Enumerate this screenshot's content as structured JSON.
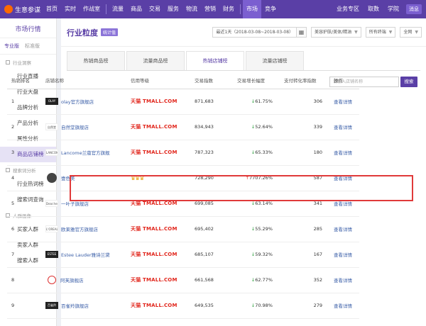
{
  "app": {
    "logo_text": "生意参谋"
  },
  "topnav": {
    "items": [
      "首页",
      "实时",
      "作战室",
      "流量",
      "商品",
      "交易",
      "服务",
      "物流",
      "营销",
      "财务",
      "市场",
      "竞争"
    ],
    "active_index": 10,
    "right_items": [
      "业务专区",
      "取数",
      "学院"
    ],
    "user_label": "消息"
  },
  "sidebar": {
    "title": "市场行情",
    "tabs": [
      "专业版",
      "标准版"
    ],
    "groups": [
      {
        "label": "行业洞察",
        "items": [
          "行业直播",
          "行业大盘",
          "品牌分析",
          "产品分析",
          "属性分析",
          "商品店铺榜"
        ]
      },
      {
        "label": "搜索词分析",
        "items": [
          "行业热词榜",
          "搜索词查询"
        ]
      },
      {
        "label": "人群画像",
        "items": [
          "买家人群",
          "卖家人群",
          "搜索人群"
        ]
      }
    ],
    "active_item": "商品店铺榜"
  },
  "main": {
    "title": "行业粒度",
    "title_badge": "统计值",
    "date_range": "最近1天（2018-03-08~2018-03-08）",
    "category_select": "美容护肤/美体/精油",
    "terminal_select": "所有终端",
    "scope_select": "全网",
    "tabs": [
      "热销商品榜",
      "流量商品榜",
      "热销店铺榜",
      "流量店铺榜"
    ],
    "active_tab": 2,
    "search": {
      "placeholder": "请输入店铺名称",
      "button": "搜索"
    }
  },
  "table": {
    "headers": [
      "热销排名",
      "店铺名称",
      "信用等级",
      "交易指数",
      "交易增长幅度",
      "支付转化率指数",
      "操作"
    ],
    "rows": [
      {
        "rank": "1",
        "logo": "OLAY",
        "logo_style": "dark",
        "name": "olay官方旗舰店",
        "credit": "天猫 TMALL.COM",
        "credit_type": "tmall",
        "index": "871,683",
        "growth": "61.75%",
        "growth_dir": "down",
        "conv": "306",
        "action": "查看详情"
      },
      {
        "rank": "2",
        "logo": "自然堂",
        "logo_style": "light",
        "name": "自然堂旗舰店",
        "credit": "天猫 TMALL.COM",
        "credit_type": "tmall",
        "index": "834,943",
        "growth": "52.64%",
        "growth_dir": "down",
        "conv": "339",
        "action": "查看详情"
      },
      {
        "rank": "3",
        "logo": "LANCOME",
        "logo_style": "light",
        "name": "Lancome兰蔻官方旗舰",
        "credit": "天猫 TMALL.COM",
        "credit_type": "tmall",
        "index": "787,323",
        "growth": "65.33%",
        "growth_dir": "down",
        "conv": "180",
        "action": "查看详情"
      },
      {
        "rank": "4",
        "logo": "",
        "logo_style": "round",
        "name": "壹色美",
        "credit": "♛♛♛",
        "credit_type": "crown",
        "index": "728,290",
        "growth": "7707.26%",
        "growth_dir": "up",
        "conv": "587",
        "action": "查看详情"
      },
      {
        "rank": "5",
        "logo": "Dear.her",
        "logo_style": "light",
        "name": "一叶子旗舰店",
        "credit": "天猫 TMALL.COM",
        "credit_type": "tmall",
        "index": "699,085",
        "growth": "63.14%",
        "growth_dir": "down",
        "conv": "341",
        "action": "查看详情"
      },
      {
        "rank": "6",
        "logo": "L'OREAL",
        "logo_style": "light",
        "name": "欧莱雅官方旗舰店",
        "credit": "天猫 TMALL.COM",
        "credit_type": "tmall",
        "index": "695,402",
        "growth": "55.29%",
        "growth_dir": "down",
        "conv": "285",
        "action": "查看详情"
      },
      {
        "rank": "7",
        "logo": "ESTEE",
        "logo_style": "dark",
        "name": "Estee Lauder雅诗兰黛",
        "credit": "天猫 TMALL.COM",
        "credit_type": "tmall",
        "index": "685,107",
        "growth": "59.32%",
        "growth_dir": "down",
        "conv": "167",
        "action": "查看详情"
      },
      {
        "rank": "8",
        "logo": "",
        "logo_style": "circ",
        "name": "阿芙旗舰店",
        "credit": "天猫 TMALL.COM",
        "credit_type": "tmall",
        "index": "661,568",
        "growth": "62.77%",
        "growth_dir": "down",
        "conv": "352",
        "action": "查看详情"
      },
      {
        "rank": "9",
        "logo": "百雀羚",
        "logo_style": "dark",
        "name": "百雀羚旗舰店",
        "credit": "天猫 TMALL.COM",
        "credit_type": "tmall",
        "index": "649,535",
        "growth": "70.98%",
        "growth_dir": "down",
        "conv": "279",
        "action": "查看详情"
      }
    ]
  },
  "colors": {
    "brand": "#5a3fa6",
    "tmall_red": "#e1251b",
    "down_green": "#2a9d3a",
    "highlight": "#e03a3a"
  }
}
